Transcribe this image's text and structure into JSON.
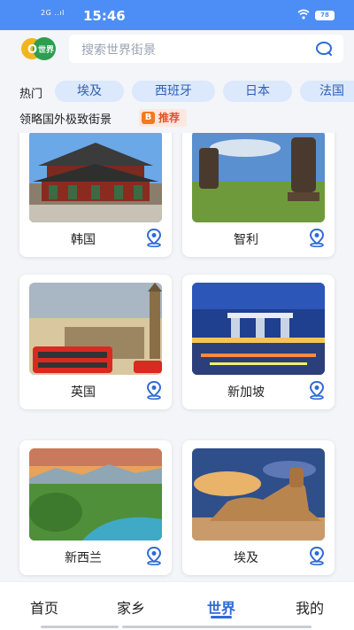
{
  "status_bar": {
    "signal": "2G ..ıl",
    "time": "15:46",
    "battery": "78"
  },
  "header": {
    "logo_text": "O世界",
    "search_placeholder": "搜索世界街景"
  },
  "hot": {
    "label": "热门",
    "chips": [
      "埃及",
      "西班牙",
      "日本",
      "法国"
    ]
  },
  "recommend": {
    "text": "领略国外极致街景",
    "badge_icon_char": "B",
    "badge_label": "推荐"
  },
  "places": [
    {
      "name": "韩国"
    },
    {
      "name": "智利"
    },
    {
      "name": "英国"
    },
    {
      "name": "新加坡"
    },
    {
      "name": "新西兰"
    },
    {
      "name": "埃及"
    }
  ],
  "tabs": [
    {
      "label": "首页",
      "active": false
    },
    {
      "label": "家乡",
      "active": false
    },
    {
      "label": "世界",
      "active": true
    },
    {
      "label": "我的",
      "active": false
    }
  ],
  "colors": {
    "accent": "#2f6ad8",
    "status_bar": "#4c8ef5",
    "chip_bg": "#dce8fb",
    "badge": "#e0502a"
  }
}
